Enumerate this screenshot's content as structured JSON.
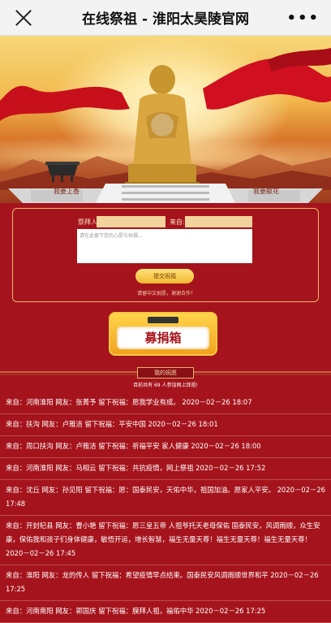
{
  "header": {
    "title": "在线祭祖 - 淮阳太昊陵官网"
  },
  "hero": {
    "left_label": "我要上香",
    "right_label": "我要献花"
  },
  "form": {
    "name_label": "祭拜人:",
    "from_label": "来自:",
    "message_placeholder": "请在此留下您的心愿与祝福...",
    "submit_label": "提交祝福",
    "hint": "请留中文祝愿，谢谢合作！"
  },
  "donate": {
    "label": "募捐箱"
  },
  "section": {
    "title": "我的祝愿",
    "count_text": "目前共有 69 人参加网上拜祖!"
  },
  "messages": [
    {
      "text": "来自：河南淮阳 网友：张菁予 留下祝福：愿我学业有成。 2020－02－26 18:07"
    },
    {
      "text": "来自：扶沟 网友：卢雅洁 留下祝福：平安中国 2020－02－26 18:01"
    },
    {
      "text": "来自：周口扶沟 网友：卢雅洁 留下祝福：祈福平安 家人健康 2020－02－26 18:00"
    },
    {
      "text": "来自：河南淮阳 网友：马相云 留下祝福：共抗疫情，网上祭祖 2020－02－26 17:52"
    },
    {
      "text": "来自：沈丘 网友：孙见阳 留下祝福：愿：国泰民安，天佑中华，祖国加油。愿家人平安。 2020－02－26 17:48"
    },
    {
      "text": "来自：开封杞县 网友：曹小艳 留下祝福：愿三皇五帝 人祖爷托天老母保佑 国泰民安，风调雨顺，众生安康，保佑我和孩子们身体健康，敏悟开运，增长智慧，福生无量天尊！福生无量天尊！福生无量天尊！ 2020－02－26 17:45"
    },
    {
      "text": "来自：淮阳 网友：龙的传人 留下祝福：希望疫情早点结束。国泰民安风调雨顺世界和平 2020－02－26 17:25"
    },
    {
      "text": "来自：河南南阳 网友：郭国庆 留下祝福：膜拜人祖，福佑中华 2020－02－26 17:25"
    }
  ],
  "colors": {
    "background": "#a5141c",
    "accent": "#f0b830",
    "input": "#f3d39c"
  },
  "icons": {
    "close": "close-icon",
    "more": "more-icon"
  }
}
